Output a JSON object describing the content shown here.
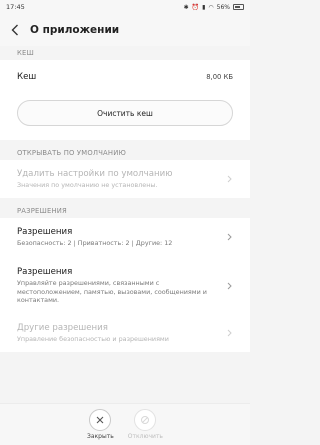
{
  "status_bar": {
    "time": "17:45",
    "battery": "56%"
  },
  "header": {
    "title": "О приложении"
  },
  "cache_section": {
    "header": "КЕШ",
    "row_title": "Кеш",
    "row_value": "8,00 КБ",
    "clear_button": "Очистить кеш"
  },
  "default_section": {
    "header": "ОТКРЫВАТЬ ПО УМОЛЧАНИЮ",
    "item": {
      "title": "Удалить настройки по умолчанию",
      "subtitle": "Значения по умолчанию не установлены."
    }
  },
  "permissions_section": {
    "header": "РАЗРЕШЕНИЯ",
    "items": [
      {
        "title": "Разрешения",
        "subtitle": "Безопасность: 2 | Приватность: 2 | Другие: 12"
      },
      {
        "title": "Разрешения",
        "subtitle": "Управляйте разрешениями, связанными с местоположением, памятью, вызовами, сообщениями и контактами."
      },
      {
        "title": "Другие разрешения",
        "subtitle": "Управление безопасностью и разрешениями"
      }
    ]
  },
  "bottom_actions": {
    "close": "Закрыть",
    "disable": "Отключить"
  }
}
